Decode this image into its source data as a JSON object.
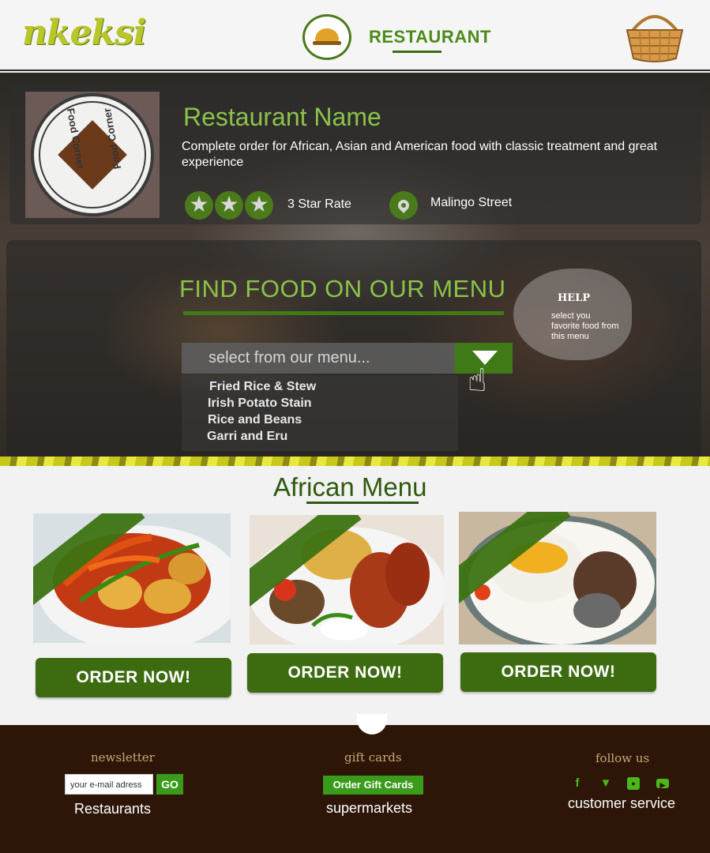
{
  "header": {
    "logo_text": "nkeksi",
    "nav_title": "RESTAURANT"
  },
  "restaurant": {
    "name": "Restaurant Name",
    "logo_ring_text": "Food Corner",
    "description": "Complete order for African, Asian and American food with classic treatment and great experience",
    "rating_stars": 3,
    "rating_label": "3 Star Rate",
    "location": "Malingo Street"
  },
  "find_food": {
    "title": "FIND FOOD ON OUR MENU",
    "placeholder": "select from our menu...",
    "help_title": "HELP",
    "help_text": "select you favorite food from this menu",
    "menu_items": [
      "Fried Rice & Stew",
      "Irish Potato Stain",
      "Rice and Beans",
      "Garri and Eru"
    ]
  },
  "african_menu": {
    "title": "African Menu",
    "items": [
      {
        "order_label": "ORDER NOW!"
      },
      {
        "order_label": "ORDER NOW!"
      },
      {
        "order_label": "ORDER NOW!"
      }
    ]
  },
  "footer": {
    "newsletter_title": "newsletter",
    "email_placeholder": "your e-mail adress",
    "go_label": "GO",
    "restaurants_link": "Restaurants",
    "gift_title": "gift cards",
    "gift_button": "Order Gift Cards",
    "supermarkets_link": "supermarkets",
    "follow_title": "follow us",
    "social_icons": [
      "facebook-icon",
      "twitter-icon",
      "instagram-icon",
      "youtube-icon"
    ],
    "customer_service_link": "customer service"
  },
  "colors": {
    "brand_green": "#3d6b10",
    "accent_light_green": "#8bc34a",
    "footer_bg": "#2d1608"
  }
}
